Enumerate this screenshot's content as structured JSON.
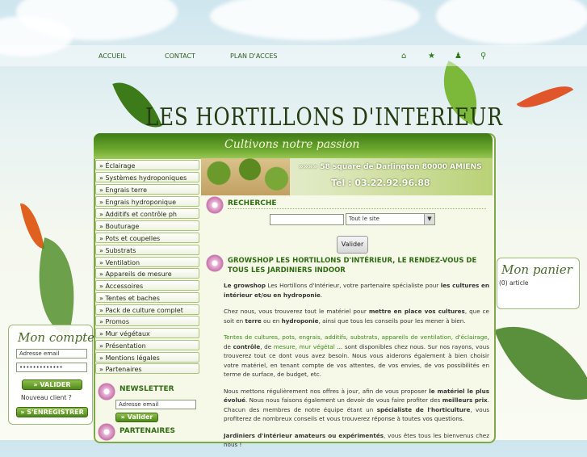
{
  "nav": {
    "links": [
      "ACCUEIL",
      "CONTACT",
      "PLAN D'ACCES"
    ],
    "icons": [
      "home-icon",
      "star-icon",
      "users-icon",
      "sitemap-icon"
    ]
  },
  "logo": {
    "text": "LES  HORTILLONS  D'INTERIEUR"
  },
  "slogan": "Cultivons notre passion",
  "banner": {
    "address": "»»»» 58 square de Darlington  80000 AMIENS",
    "phone": "Tél : 03.22.92.96.88"
  },
  "menu": [
    "» Éclairage",
    "» Systèmes hydroponiques",
    "» Engrais terre",
    "» Engrais hydroponique",
    "» Additifs et contrôle ph",
    "» Bouturage",
    "» Pots et coupelles",
    "» Substrats",
    "» Ventilation",
    "» Appareils de mesure",
    "» Accessoires",
    "» Tentes et baches",
    "» Pack de culture complet",
    "» Promos",
    "» Mur végétaux",
    "» Présentation",
    "» Mentions légales",
    "» Partenaires"
  ],
  "search": {
    "title": "RECHERCHE",
    "select_value": "Tout le site",
    "button": "Valider"
  },
  "newsletter": {
    "title": "NEWSLETTER",
    "placeholder": "Adresse email",
    "button": "» Valider"
  },
  "partners": {
    "title": "PARTENAIRES"
  },
  "account": {
    "title": "Mon compte",
    "email_value": "Adresse email",
    "password_value": "•••••••••••••",
    "validate": "» VALIDER",
    "new_client": "Nouveau client ?",
    "register": "» S'ENREGISTRER"
  },
  "cart": {
    "title": "Mon panier",
    "count": "(0) article"
  },
  "main": {
    "heading": "GROWSHOP LES HORTILLONS D'INTÉRIEUR, LE RENDEZ-VOUS DE TOUS LES JARDINIERS INDOOR",
    "p1_a": "Le growshop",
    "p1_b": " Les Hortillons d'Intérieur, votre partenaire spécialiste pour ",
    "p1_c": "les cultures en intérieur et/ou en hydroponie",
    "p1_d": ".",
    "p2_a": "Chez nous, vous trouverez tout le matériel pour ",
    "p2_b": "mettre en place vos cultures",
    "p2_c": ", que ce soit en ",
    "p2_d": "terre",
    "p2_e": " ou en ",
    "p2_f": "hydroponie",
    "p2_g": ", ainsi que tous les conseils pour les mener à bien.",
    "p3_a": "Tentes de cultures, pots, engrais, additifs, substrats, appareils de ventilation, d'éclairage",
    "p3_b": ", de ",
    "p3_c": "contrôle",
    "p3_d": ", de ",
    "p3_e": "mesure, mur végétal",
    "p3_f": " ... sont disponibles chez nous. Sur nos rayons, vous trouverez tout ce dont vous avez besoin. Nous vous aiderons également à bien choisir votre matériel, en tenant compte de vos attentes, de vos envies, de vos possibilités en terme de surface, de budget, etc.",
    "p4_a": "Nous mettons régulièrement nos offres à jour, afin de vous proposer ",
    "p4_b": "le matériel le plus évolué",
    "p4_c": ". Nous nous faisons également un devoir de vous faire profiter des ",
    "p4_d": "meilleurs prix",
    "p4_e": ". Chacun des membres de notre équipe étant un ",
    "p4_f": "spécialiste de l'horticulture",
    "p4_g": ", vous profiterez de nombreux conseils et vous trouverez réponse à toutes vos questions.",
    "p5_a": "Jardiniers d'intérieur amateurs ou expérimentés",
    "p5_b": ", vous êtes tous les bienvenus chez nous !"
  }
}
